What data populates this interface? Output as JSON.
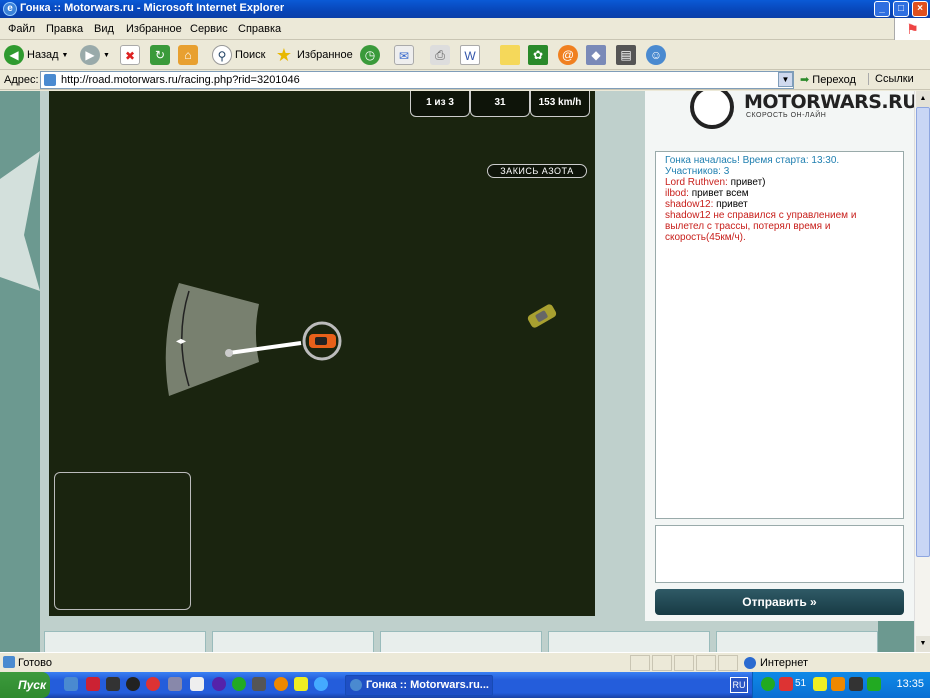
{
  "window": {
    "title": "Гонка :: Motorwars.ru - Microsoft Internet Explorer"
  },
  "menu": [
    "Файл",
    "Правка",
    "Вид",
    "Избранное",
    "Сервис",
    "Справка"
  ],
  "toolbar": {
    "back": "Назад",
    "search": "Поиск",
    "favorites": "Избранное"
  },
  "address": {
    "label": "Адрес:",
    "url": "http://road.motorwars.ru/racing.php?rid=3201046",
    "go": "Переход",
    "links": "Ссылки"
  },
  "hud": {
    "lap": "1 из 3",
    "counter": "31",
    "speed": "153 km/h",
    "nitro": "ЗАКИСЬ АЗОТА"
  },
  "logo": {
    "name": "MOTORWARS.RU",
    "tagline": "СКОРОСТЬ ОН-ЛАЙН"
  },
  "chat": {
    "system": "Гонка началась! Время старта: 13:30. Участников: 3",
    "messages": [
      {
        "nick": "Lord Ruthven:",
        "text": "привет)"
      },
      {
        "nick": "ilbod:",
        "text": "привет всем"
      },
      {
        "nick": "shadow12:",
        "text": "привет"
      }
    ],
    "event": "shadow12 не справился с управлением и вылетел с трассы, потерял время и скорость(45км/ч)."
  },
  "send_label": "Отправить »",
  "status": {
    "text": "Готово",
    "zone": "Интернет"
  },
  "taskbar": {
    "start": "Пуск",
    "task": "Гонка :: Motorwars.ru...",
    "lang": "RU",
    "clock": "13:35",
    "tray_number": "51"
  }
}
